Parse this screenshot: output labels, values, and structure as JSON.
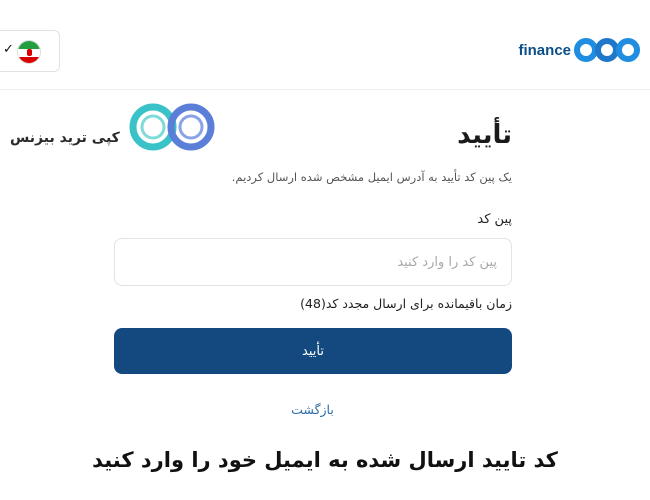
{
  "header": {
    "brand_text": "finance",
    "language": {
      "checkmark": "✓",
      "flag": "iran-flag"
    }
  },
  "watermark": {
    "text": "کپی ترید بیزنس"
  },
  "form": {
    "title": "تأیید",
    "description": "یک پین کد تأیید به آدرس ایمیل مشخص شده ارسال کردیم.",
    "pin_label": "پین کد",
    "pin_placeholder": "پین کد را وارد کنید",
    "pin_value": "",
    "timer_text": "زمان باقیمانده برای ارسال مجدد کد(48)",
    "confirm_label": "تأیید",
    "back_label": "بازگشت"
  },
  "caption": "کد تایید ارسال شده به ایمیل خود را وارد کنید",
  "colors": {
    "primary": "#14497f",
    "link": "#2e6da8",
    "brand": "#1f8ee0"
  }
}
